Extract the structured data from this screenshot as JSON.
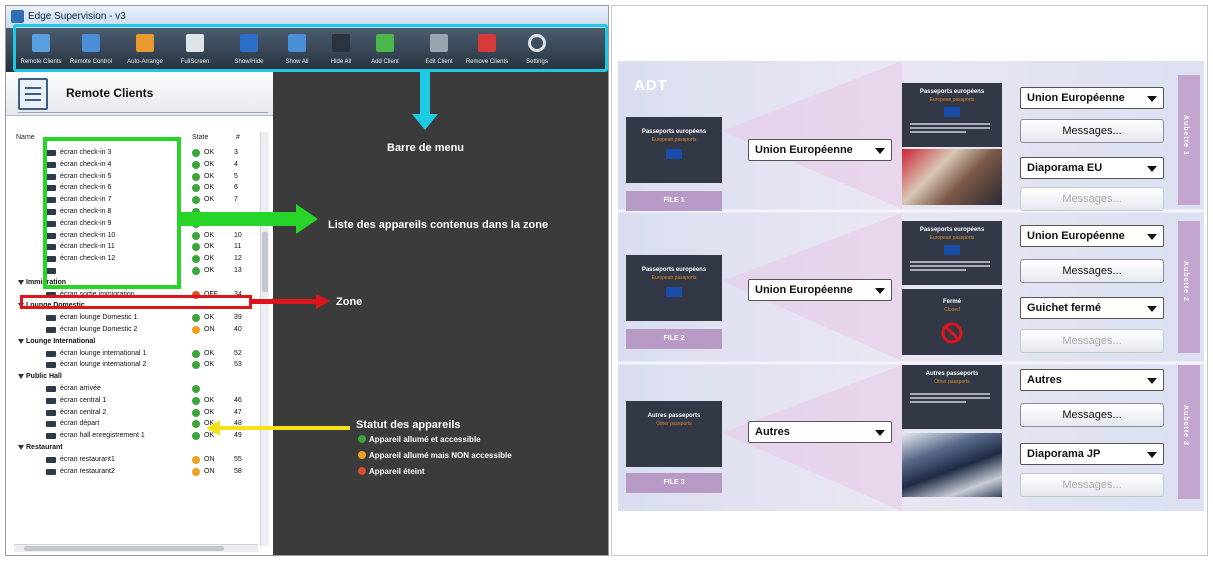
{
  "left": {
    "window_title": "Edge Supervision - v3",
    "toolbar": [
      {
        "label": "Remote Clients",
        "icon": "remote-clients-icon",
        "color": "#5aa0e0"
      },
      {
        "label": "Remote Control",
        "icon": "remote-control-icon",
        "color": "#4a8fd8"
      },
      {
        "label": "Auto-Arrange",
        "icon": "auto-arrange-icon",
        "color": "#e89a30"
      },
      {
        "label": "FullScreen",
        "icon": "fullscreen-icon",
        "color": "#dfe4ea"
      },
      {
        "label": "Show/Hide",
        "icon": "show-hide-icon",
        "color": "#2b6fc9"
      },
      {
        "label": "Show All",
        "icon": "show-all-icon",
        "color": "#4a8fd8"
      },
      {
        "label": "Hide All",
        "icon": "hide-all-icon",
        "color": "#2a3340"
      },
      {
        "label": "Add Client",
        "icon": "add-client-icon",
        "color": "#4cb84c"
      },
      {
        "label": "Edit Client",
        "icon": "edit-client-icon",
        "color": "#9aa4ae"
      },
      {
        "label": "Remove Clients",
        "icon": "remove-clients-icon",
        "color": "#d83a3a"
      },
      {
        "label": "Settings",
        "icon": "settings-icon",
        "color": "#e0e4ea"
      }
    ],
    "panel_title": "Remote Clients",
    "columns": {
      "name": "Name",
      "state": "State",
      "num": "#"
    },
    "rows": [
      {
        "type": "item",
        "name": "écran check-in 3",
        "state": "OK",
        "status": "ok",
        "num": "3"
      },
      {
        "type": "item",
        "name": "écran check-in 4",
        "state": "OK",
        "status": "ok",
        "num": "4"
      },
      {
        "type": "item",
        "name": "écran check-in 5",
        "state": "OK",
        "status": "ok",
        "num": "5"
      },
      {
        "type": "item",
        "name": "écran check-in 6",
        "state": "OK",
        "status": "ok",
        "num": "6"
      },
      {
        "type": "item",
        "name": "écran check-in 7",
        "state": "OK",
        "status": "ok",
        "num": "7"
      },
      {
        "type": "item",
        "name": "écran check-in 8",
        "state": "",
        "status": "ok",
        "num": ""
      },
      {
        "type": "item",
        "name": "écran check-in 9",
        "state": "OK",
        "status": "ok",
        "num": "9"
      },
      {
        "type": "item",
        "name": "écran check-in 10",
        "state": "OK",
        "status": "ok",
        "num": "10"
      },
      {
        "type": "item",
        "name": "écran check-in 11",
        "state": "OK",
        "status": "ok",
        "num": "11"
      },
      {
        "type": "item",
        "name": "écran check-in 12",
        "state": "OK",
        "status": "ok",
        "num": "12"
      },
      {
        "type": "item",
        "name": "",
        "state": "OK",
        "status": "ok",
        "num": "13"
      },
      {
        "type": "group",
        "name": "Immigration"
      },
      {
        "type": "item",
        "name": "écran sortie immigration",
        "state": "OFF",
        "status": "off",
        "num": "34"
      },
      {
        "type": "group",
        "name": "Lounge Domestic"
      },
      {
        "type": "item",
        "name": "écran lounge Domestic 1",
        "state": "OK",
        "status": "ok",
        "num": "39"
      },
      {
        "type": "item",
        "name": "écran lounge Domestic 2",
        "state": "ON",
        "status": "on",
        "num": "40"
      },
      {
        "type": "group",
        "name": "Lounge International"
      },
      {
        "type": "item",
        "name": "écran lounge international 1",
        "state": "OK",
        "status": "ok",
        "num": "52"
      },
      {
        "type": "item",
        "name": "écran lounge international 2",
        "state": "OK",
        "status": "ok",
        "num": "53"
      },
      {
        "type": "group",
        "name": "Public Hall"
      },
      {
        "type": "item",
        "name": "écran arrivée",
        "state": "",
        "status": "ok",
        "num": ""
      },
      {
        "type": "item",
        "name": "écran central 1",
        "state": "OK",
        "status": "ok",
        "num": "46"
      },
      {
        "type": "item",
        "name": "écran central 2",
        "state": "OK",
        "status": "ok",
        "num": "47"
      },
      {
        "type": "item",
        "name": "écran départ",
        "state": "OK",
        "status": "ok",
        "num": "48"
      },
      {
        "type": "item",
        "name": "écran hall enregistrement 1",
        "state": "OK",
        "status": "ok",
        "num": "49"
      },
      {
        "type": "group",
        "name": "Restaurant"
      },
      {
        "type": "item",
        "name": "écran restaurant1",
        "state": "ON",
        "status": "on",
        "num": "55"
      },
      {
        "type": "item",
        "name": "écran restaurant2",
        "state": "ON",
        "status": "on",
        "num": "58"
      }
    ],
    "annotations": {
      "menu_bar": "Barre de menu",
      "device_list": "Liste des appareils contenus dans la zone",
      "zone": "Zone",
      "status_title": "Statut des appareils",
      "legend_ok": "Appareil allumé et accessible",
      "legend_on": "Appareil allumé mais NON accessible",
      "legend_off": "Appareil éteint"
    },
    "colors": {
      "menu_box": "#1ec9e4",
      "list_box": "#27d427",
      "zone_box": "#e0151b",
      "status_arrow": "#f5e21a"
    }
  },
  "right": {
    "logo": "ADT",
    "files": [
      {
        "label": "FILE 1",
        "screen_title": "Passeports européens",
        "screen_sub": "European passports",
        "dropdown": "Union Européenne"
      },
      {
        "label": "FILE 2",
        "screen_title": "Passeports européens",
        "screen_sub": "European passports",
        "dropdown": "Union Européenne"
      },
      {
        "label": "FILE 3",
        "screen_title": "Autres passeports",
        "screen_sub": "Other passports",
        "dropdown": "Autres"
      }
    ],
    "aubettes": [
      {
        "label": "Aubette 1",
        "top_screen_title": "Passeports européens",
        "top_screen_sub": "European passports",
        "dd1": "Union Européenne",
        "btn1": "Messages...",
        "dd2": "Diaporama EU",
        "btn2": "Messages..."
      },
      {
        "label": "Aubette 2",
        "top_screen_title": "Passeports européens",
        "top_screen_sub": "European passports",
        "bottom_screen_title": "Fermé",
        "bottom_screen_sub": "Closed",
        "dd1": "Union Européenne",
        "btn1": "Messages...",
        "dd2": "Guichet fermé",
        "btn2": "Messages..."
      },
      {
        "label": "Aubette 3",
        "top_screen_title": "Autres passeports",
        "top_screen_sub": "Other passports",
        "dd1": "Autres",
        "btn1": "Messages...",
        "dd2": "Diaporama JP",
        "btn2": "Messages..."
      }
    ]
  }
}
